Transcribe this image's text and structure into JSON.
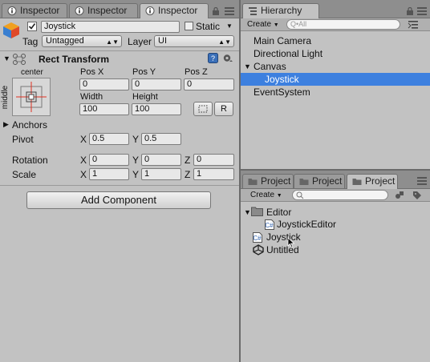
{
  "inspector_tabs": [
    "Inspector",
    "Inspector",
    "Inspector"
  ],
  "hierarchy": {
    "tab": "Hierarchy",
    "create_label": "Create",
    "search_placeholder": "Q•All",
    "items": [
      "Main Camera",
      "Directional Light",
      "Canvas",
      "Joystick",
      "EventSystem"
    ],
    "selected": "Joystick"
  },
  "object": {
    "name": "Joystick",
    "static_label": "Static",
    "tag_label": "Tag",
    "tag_value": "Untagged",
    "layer_label": "Layer",
    "layer_value": "UI"
  },
  "rect_transform": {
    "title": "Rect Transform",
    "anchor_h": "center",
    "anchor_v": "middle",
    "pos_x_label": "Pos X",
    "pos_y_label": "Pos Y",
    "pos_z_label": "Pos Z",
    "pos_x": "0",
    "pos_y": "0",
    "pos_z": "0",
    "width_label": "Width",
    "height_label": "Height",
    "width": "100",
    "height": "100",
    "r_button": "R",
    "anchors_label": "Anchors",
    "pivot_label": "Pivot",
    "pivot_x": "0.5",
    "pivot_y": "0.5",
    "rotation_label": "Rotation",
    "rotation_x": "0",
    "rotation_y": "0",
    "rotation_z": "0",
    "scale_label": "Scale",
    "scale_x": "1",
    "scale_y": "1",
    "scale_z": "1",
    "x": "X",
    "y": "Y",
    "z": "Z"
  },
  "add_component": "Add Component",
  "project": {
    "tabs": [
      "Project",
      "Project",
      "Project"
    ],
    "create_label": "Create",
    "items": [
      "Editor",
      "JoystickEditor",
      "Joystick",
      "Untitled"
    ]
  },
  "colors": {
    "selection": "#3d80df",
    "panel": "#c2c2c2",
    "tabbar": "#8e8e8e"
  }
}
